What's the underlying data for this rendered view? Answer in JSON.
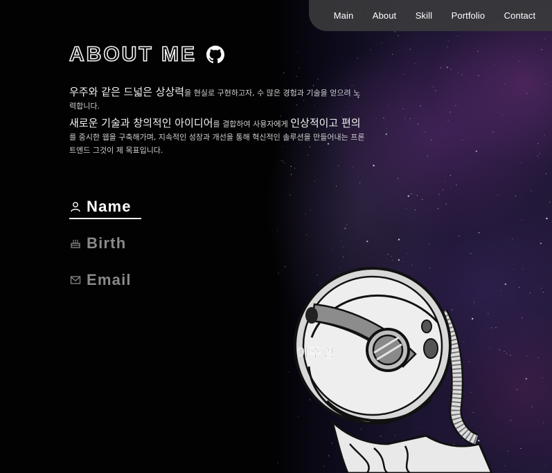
{
  "nav": {
    "items": [
      {
        "label": "Main"
      },
      {
        "label": "About"
      },
      {
        "label": "Skill"
      },
      {
        "label": "Portfolio"
      },
      {
        "label": "Contact"
      }
    ]
  },
  "about": {
    "heading": "ABOUT ME",
    "github_icon": "github-icon",
    "intro": {
      "p1_big": "우주와 같은 드넓은 상상력",
      "p1_rest": "을 현실로 구현하고자, 수 많은 경험과 기술을 얻으려 노력합니다.",
      "p2_big1": "새로운 기술과 창의적인 아이디어",
      "p2_mid": "를 결합하여 사용자에게 ",
      "p2_big2": "인상적이고 편의",
      "p2_rest": "를 중시한 웹을 구축해가며, 지속적인 성장과 개선을 통해 혁신적인 솔루션을 만들어내는 프론트엔드 그것이 제 목표입니다."
    },
    "info": [
      {
        "icon": "person-icon",
        "label": "Name",
        "active": true
      },
      {
        "icon": "cake-icon",
        "label": "Birth",
        "active": false
      },
      {
        "icon": "mail-icon",
        "label": "Email",
        "active": false
      }
    ],
    "name_value": "이주영"
  },
  "colors": {
    "background": "#030305",
    "nav_bg": "#3a3a3c",
    "text_primary": "#ffffff",
    "text_muted": "#8a8a8a",
    "nebula": "#5c2c74"
  }
}
